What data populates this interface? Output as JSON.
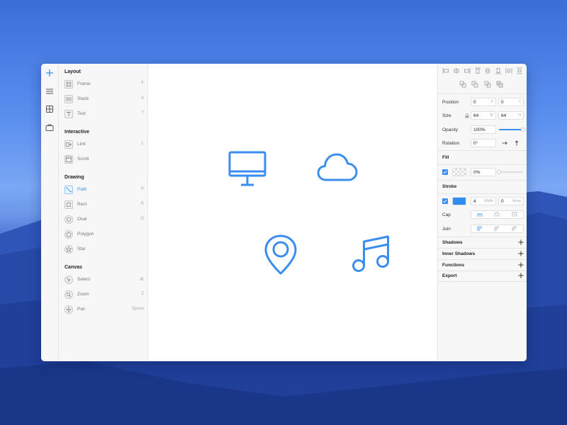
{
  "colors": {
    "accent": "#3b8ef0",
    "panel_bg": "#f7f7f7",
    "canvas_bg": "#ffffff",
    "stroke_swatch": "#2f8df2"
  },
  "rail": {
    "items": [
      {
        "icon": "plus-icon"
      },
      {
        "icon": "menu-icon"
      },
      {
        "icon": "grid-icon"
      },
      {
        "icon": "briefcase-icon"
      }
    ]
  },
  "tools": {
    "layout": {
      "title": "Layout",
      "items": [
        {
          "label": "Frame",
          "key": "F",
          "icon": "frame-icon"
        },
        {
          "label": "Stack",
          "key": "S",
          "icon": "stack-icon"
        },
        {
          "label": "Text",
          "key": "T",
          "icon": "text-icon"
        }
      ]
    },
    "interactive": {
      "title": "Interactive",
      "items": [
        {
          "label": "Link",
          "key": "L",
          "icon": "link-icon"
        },
        {
          "label": "Scroll",
          "key": "",
          "icon": "scroll-icon"
        }
      ]
    },
    "drawing": {
      "title": "Drawing",
      "items": [
        {
          "label": "Path",
          "key": "P",
          "icon": "path-icon"
        },
        {
          "label": "Rect",
          "key": "R",
          "icon": "rect-icon"
        },
        {
          "label": "Oval",
          "key": "O",
          "icon": "oval-icon"
        },
        {
          "label": "Polygon",
          "key": "",
          "icon": "polygon-icon"
        },
        {
          "label": "Star",
          "key": "",
          "icon": "star-icon"
        }
      ]
    },
    "canvas": {
      "title": "Canvas",
      "items": [
        {
          "label": "Select",
          "key": "⌘",
          "icon": "select-icon"
        },
        {
          "label": "Zoom",
          "key": "Z",
          "icon": "zoom-icon"
        },
        {
          "label": "Pan",
          "key": "Space",
          "icon": "pan-icon"
        }
      ]
    }
  },
  "canvas": {
    "icons": [
      {
        "name": "monitor-icon"
      },
      {
        "name": "cloud-icon"
      },
      {
        "name": "location-pin-icon"
      },
      {
        "name": "music-note-icon"
      }
    ]
  },
  "inspector": {
    "position": {
      "label": "Position",
      "x": "0",
      "x_unit": "X",
      "y": "0",
      "y_unit": "Y"
    },
    "size": {
      "label": "Size",
      "w": "64",
      "w_unit": "W",
      "h": "64",
      "h_unit": "H"
    },
    "opacity": {
      "label": "Opacity",
      "value": "100%",
      "level": 1.0
    },
    "rotation": {
      "label": "Rotation",
      "value": "0°"
    },
    "fill": {
      "label": "Fill",
      "value": "0%",
      "level": 0.0
    },
    "stroke": {
      "label": "Stroke",
      "width": "4",
      "width_unit": "Width",
      "array": "0",
      "array_unit": "Array"
    },
    "cap": {
      "label": "Cap"
    },
    "join": {
      "label": "Join"
    },
    "sections": [
      {
        "label": "Shadows"
      },
      {
        "label": "Inner Shadows"
      },
      {
        "label": "Functions"
      },
      {
        "label": "Export"
      }
    ]
  }
}
